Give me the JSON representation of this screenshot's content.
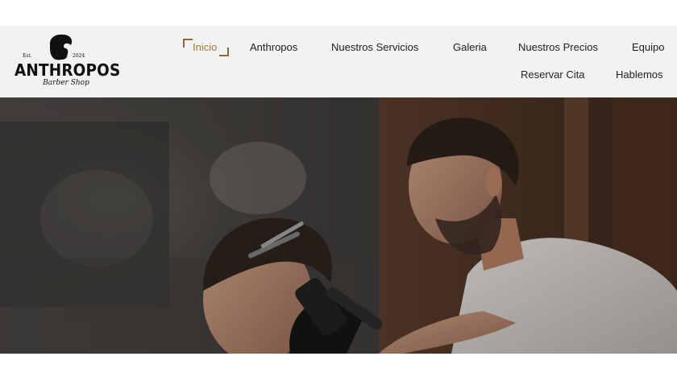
{
  "brand": {
    "est": "Est.",
    "year": "2024",
    "name": "ANTHROPOS",
    "tagline": "Barber Shop"
  },
  "nav": {
    "items": [
      {
        "label": "Inicio",
        "active": true
      },
      {
        "label": "Anthropos"
      },
      {
        "label": "Nuestros Servicios"
      },
      {
        "label": "Galeria"
      },
      {
        "label": "Nuestros Precios"
      },
      {
        "label": "Equipo"
      },
      {
        "label": "Reservar Cita"
      },
      {
        "label": "Hablemos"
      }
    ]
  },
  "colors": {
    "accent": "#a07a44",
    "header_bg": "#f2f2f2",
    "text": "#222222"
  },
  "hero": {
    "image": "barber-cutting-hair-photo"
  }
}
